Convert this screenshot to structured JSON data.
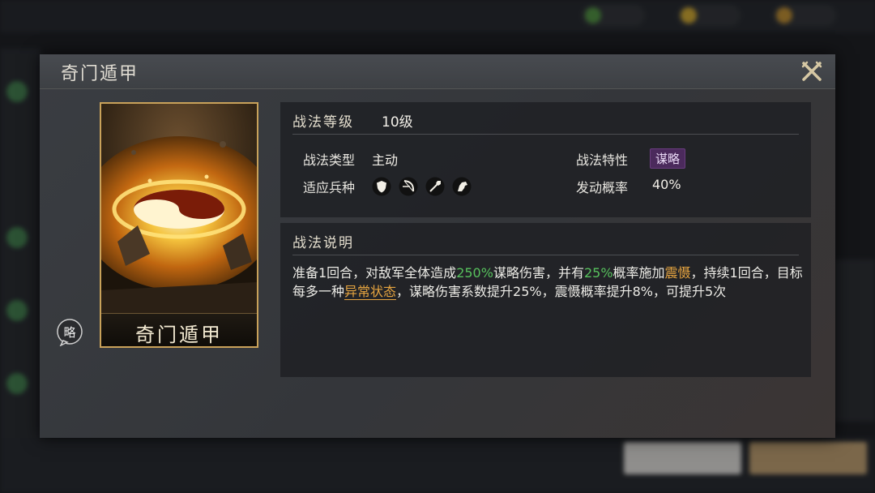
{
  "modal": {
    "title": "奇门遁甲"
  },
  "card": {
    "name": "奇门遁甲",
    "strategy_badge": "略"
  },
  "stats": {
    "level_label": "战法等级",
    "level_value": "10级",
    "type_label": "战法类型",
    "type_value": "主动",
    "trait_label": "战法特性",
    "trait_value": "谋略",
    "units_label": "适应兵种",
    "units": [
      "shield-icon",
      "bow-icon",
      "spear-icon",
      "horse-icon"
    ],
    "chance_label": "发动概率",
    "chance_value": "40%"
  },
  "description": {
    "heading": "战法说明",
    "segments": [
      {
        "text": "准备1回合，对敌军全体造成",
        "style": "normal"
      },
      {
        "text": "250%",
        "style": "green"
      },
      {
        "text": "谋略伤害，并有",
        "style": "normal"
      },
      {
        "text": "25%",
        "style": "green"
      },
      {
        "text": "概率施加",
        "style": "normal"
      },
      {
        "text": "震慑",
        "style": "orange"
      },
      {
        "text": "，持续1回合，目标每多一种",
        "style": "normal"
      },
      {
        "text": "异常状态",
        "style": "link"
      },
      {
        "text": "，谋略伤害系数提升25%，震慑概率提升8%，可提升5次",
        "style": "normal"
      }
    ]
  },
  "colors": {
    "accent_gold": "#c9a25a",
    "highlight_green": "#57c15d",
    "highlight_orange": "#e7a540",
    "tag_purple": "#4b2a5c"
  }
}
